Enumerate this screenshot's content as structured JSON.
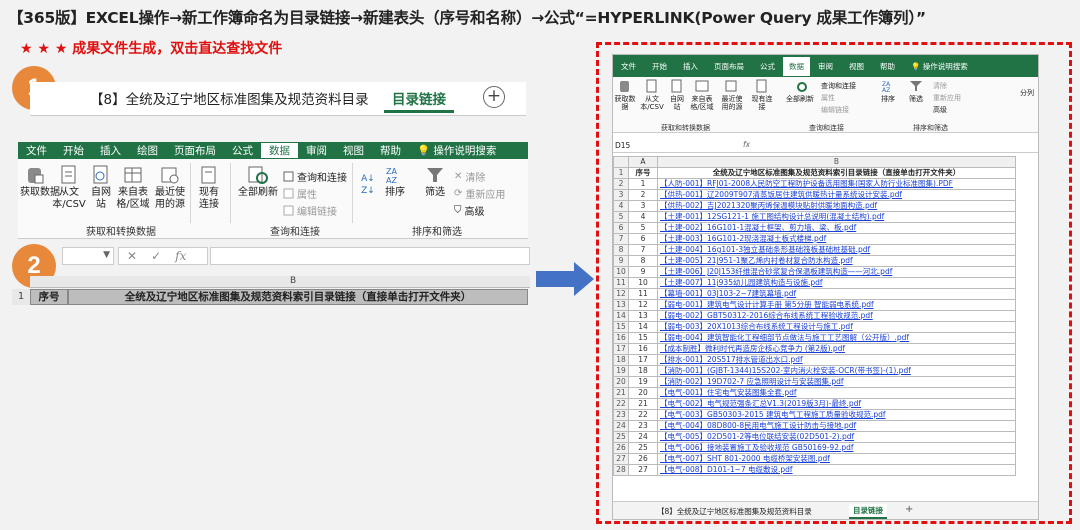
{
  "title": "【365版】EXCEL操作→新工作簿命名为目录链接→新建表头（序号和名称）→公式“=HYPERLINK(Power Query 成果工作簿列）”",
  "subtitle": "★ ★ ★ 成果文件生成，双击直达查找文件",
  "steps": {
    "one": "1",
    "two": "2"
  },
  "left_tabs": {
    "sheet1": "【8】全统及辽宁地区标准图集及规范资料目录",
    "sheet2": "目录链接",
    "add": "+"
  },
  "menu": [
    "文件",
    "开始",
    "插入",
    "绘图",
    "页面布局",
    "公式",
    "数据",
    "审阅",
    "视图",
    "帮助",
    "操作说明搜索"
  ],
  "menu_right": [
    "文件",
    "开始",
    "插入",
    "页面布局",
    "公式",
    "数据",
    "审阅",
    "视图",
    "帮助",
    "操作说明搜索"
  ],
  "ribbon": {
    "get_data": "获取数据",
    "from_text": "从文本/CSV",
    "from_web": "自网站",
    "from_table": "来自表格/区域",
    "recent": "最近使用的源",
    "existing": "现有连接",
    "refresh_all": "全部刷新",
    "queries": "查询和连接",
    "properties": "属性",
    "edit_links": "编辑链接",
    "sort": "排序",
    "filter": "筛选",
    "clear": "清除",
    "reapply": "重新应用",
    "advanced": "高级",
    "split": "分列",
    "group1": "获取和转换数据",
    "group2": "查询和连接",
    "group3": "排序和筛选"
  },
  "ribbon_right": {
    "get_data": "获取数据",
    "from_text": "从文本/CSV",
    "from_web": "自网站",
    "from_table": "来自表格/区域",
    "recent": "最近使用的源",
    "existing": "现有连接",
    "refresh_all": "全部刷新",
    "queries": "查询和连接",
    "properties": "属性",
    "edit_links": "编辑链接",
    "sort": "排序",
    "filter": "筛选",
    "clear": "清除",
    "reapply": "重新应用",
    "advanced": "高级",
    "split": "分列",
    "group1": "获取和转换数据",
    "group2": "查询和连接",
    "group3": "排序和筛选"
  },
  "fx": "fx",
  "left_sheet": {
    "col_b": "B",
    "row1": "1",
    "h_num": "序号",
    "h_name": "全统及辽宁地区标准图集及规范资料索引目录链接（直接单击打开文件夹）"
  },
  "right_sheet": {
    "namebox": "D15",
    "col_a": "A",
    "col_b": "B",
    "h_num": "序号",
    "h_name": "全统及辽宁地区标准图集及规范资料索引目录链接（直接单击打开文件夹）",
    "rows": [
      {
        "n": "1",
        "t": "【人防-001】RFJ01-2008人民防空工程防护设备选用图集(国家人防行业标准图集).PDF"
      },
      {
        "n": "2",
        "t": "【供热-001】辽2009T907清蒸饭居住建筑供暖热计量系统设计安装.pdf"
      },
      {
        "n": "3",
        "t": "【供热-002】吉J2021320聚丙烯保温模块贴射供暖地面构造.pdf"
      },
      {
        "n": "4",
        "t": "【土建-001】12SG121-1 施工图结构设计总说明(混凝土结构).pdf"
      },
      {
        "n": "5",
        "t": "【土建-002】16G101-1混凝土框架、剪力墙、梁、板.pdf"
      },
      {
        "n": "6",
        "t": "【土建-003】16G101-2现浇混凝土板式楼梯.pdf"
      },
      {
        "n": "7",
        "t": "【土建-004】16g101-3独立基础条形基础筏板基础桩基础.pdf"
      },
      {
        "n": "8",
        "t": "【土建-005】21J951-1聚乙烯内衬卷材复合防水构造.pdf"
      },
      {
        "n": "9",
        "t": "【土建-006】J20J153纤维混合砂浆复合保温板建筑构造——河北.pdf"
      },
      {
        "n": "10",
        "t": "【土建-007】11j935幼儿园建筑构造与设施.pdf"
      },
      {
        "n": "11",
        "t": "【幕墙-001】03J103-2~7建筑幕墙.pdf"
      },
      {
        "n": "12",
        "t": "【弱电-001】建筑电气设计计算手册 第5分册 智能弱电系统.pdf"
      },
      {
        "n": "13",
        "t": "【弱电-002】GBT50312-2016综合布线系统工程验收规范.pdf"
      },
      {
        "n": "14",
        "t": "【弱电-003】20X1013综合布线系统工程设计与施工.pdf"
      },
      {
        "n": "15",
        "t": "【弱电-004】建筑智能化工程细部节点做法与施工工艺图解（公开版）.pdf"
      },
      {
        "n": "16",
        "t": "【成本制胜】微利时代再造房企核心竞争力 (第2版).pdf"
      },
      {
        "n": "17",
        "t": "【排水-001】20S517排水管道出水口.pdf"
      },
      {
        "n": "18",
        "t": "【消防-001】(GJBT-1344)15S202-室内消火栓安装-OCR(带书签)-(1).pdf"
      },
      {
        "n": "19",
        "t": "【消防-002】19D702-7 应急照明设计与安装图集.pdf"
      },
      {
        "n": "20",
        "t": "【电气-001】住宅电气安装图集全套.pdf"
      },
      {
        "n": "21",
        "t": "【电气-002】电气规范强条汇总V1.3(2019版3月)-最终.pdf"
      },
      {
        "n": "22",
        "t": "【电气-003】GB50303-2015 建筑电气工程施工质量验收规范.pdf"
      },
      {
        "n": "23",
        "t": "【电气-004】08D800-8民用电气施工设计防击与接地.pdf"
      },
      {
        "n": "24",
        "t": "【电气-005】02D501-2等电位联结安装(02D501-2).pdf"
      },
      {
        "n": "25",
        "t": "【电气-006】接地装置施工及验收规范 GB50169-92.pdf"
      },
      {
        "n": "26",
        "t": "【电气-007】SHT 801-2000 电缆桥架安装图.pdf"
      },
      {
        "n": "27",
        "t": "【电气-008】D101-1~7 电缆敷设.pdf"
      }
    ]
  },
  "right_tabs": {
    "sheet1": "【8】全统及辽宁地区标准图集及规范资料目录",
    "sheet2": "目录链接",
    "add": "+"
  }
}
